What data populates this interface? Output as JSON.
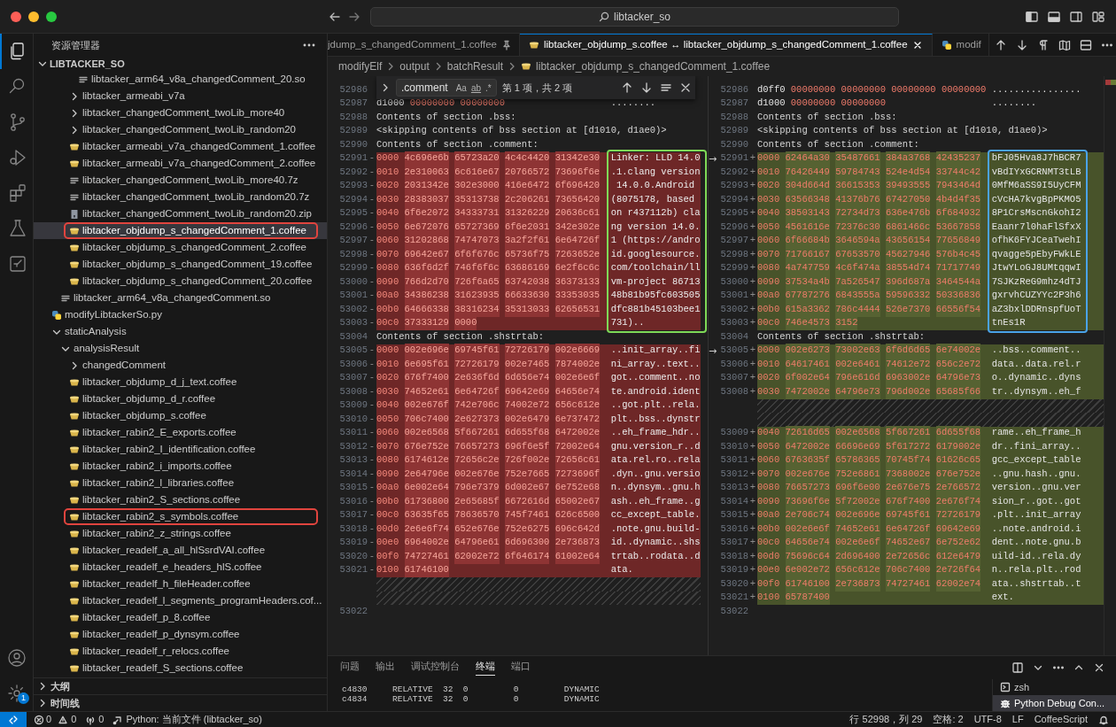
{
  "title_bar": {
    "search": "libtacker_so"
  },
  "activity_bar": {
    "items": [
      {
        "selected": true
      },
      {
        "selected": false
      },
      {
        "selected": false
      },
      {
        "selected": false
      },
      {
        "selected": false
      },
      {
        "selected": false
      },
      {
        "selected": false
      }
    ],
    "settings_badge": "1"
  },
  "sidebar": {
    "title": "资源管理器",
    "root": "LIBTACKER_SO",
    "tree": [
      {
        "children": [
          {
            "children": [
              {
                "children": [
                  {
                    "label": "libtacker_arm64_v8a_changedComment_20.so",
                    "kind": "text",
                    "selected": false,
                    "outlined": false
                  }
                ]
              },
              {
                "label": "libtacker_armeabi_v7a",
                "kind": "folder",
                "expanded": false,
                "selected": false,
                "outlined": false
              },
              {
                "label": "libtacker_changedComment_twoLib_more40",
                "kind": "folder",
                "expanded": false,
                "selected": false,
                "outlined": false
              },
              {
                "label": "libtacker_changedComment_twoLib_random20",
                "kind": "folder",
                "expanded": false,
                "selected": false,
                "outlined": false
              },
              {
                "label": "libtacker_armeabi_v7a_changedComment_1.coffee",
                "kind": "coffee",
                "selected": false,
                "outlined": false
              },
              {
                "label": "libtacker_armeabi_v7a_changedComment_2.coffee",
                "kind": "coffee",
                "selected": false,
                "outlined": false
              },
              {
                "label": "libtacker_changedComment_twoLib_more40.7z",
                "kind": "text",
                "selected": false,
                "outlined": false
              },
              {
                "label": "libtacker_changedComment_twoLib_random20.7z",
                "kind": "text",
                "selected": false,
                "outlined": false
              },
              {
                "label": "libtacker_changedComment_twoLib_random20.zip",
                "kind": "zip",
                "selected": false,
                "outlined": false
              },
              {
                "label": "libtacker_objdump_s_changedComment_1.coffee",
                "kind": "coffee",
                "selected": true,
                "outlined": true
              },
              {
                "label": "libtacker_objdump_s_changedComment_2.coffee",
                "kind": "coffee",
                "selected": false,
                "outlined": false
              },
              {
                "label": "libtacker_objdump_s_changedComment_19.coffee",
                "kind": "coffee",
                "selected": false,
                "outlined": false
              },
              {
                "label": "libtacker_objdump_s_changedComment_20.coffee",
                "kind": "coffee",
                "selected": false,
                "outlined": false
              }
            ]
          },
          {
            "label": "libtacker_arm64_v8a_changedComment.so",
            "kind": "text",
            "selected": false,
            "outlined": false
          }
        ]
      },
      {
        "label": "modifyLibtackerSo.py",
        "kind": "python",
        "selected": false,
        "outlined": false
      },
      {
        "label": "staticAnalysis",
        "kind": "folder",
        "expanded": true,
        "selected": false,
        "outlined": false,
        "children": [
          {
            "label": "analysisResult",
            "kind": "folder",
            "expanded": true,
            "selected": false,
            "outlined": false,
            "children": [
              {
                "label": "changedComment",
                "kind": "folder",
                "expanded": false,
                "selected": false,
                "outlined": false
              },
              {
                "label": "libtacker_objdump_d_j_text.coffee",
                "kind": "coffee",
                "selected": false,
                "outlined": false
              },
              {
                "label": "libtacker_objdump_d_r.coffee",
                "kind": "coffee",
                "selected": false,
                "outlined": false
              },
              {
                "label": "libtacker_objdump_s.coffee",
                "kind": "coffee",
                "selected": false,
                "outlined": false
              },
              {
                "label": "libtacker_rabin2_E_exports.coffee",
                "kind": "coffee",
                "selected": false,
                "outlined": false
              },
              {
                "label": "libtacker_rabin2_I_identification.coffee",
                "kind": "coffee",
                "selected": false,
                "outlined": false
              },
              {
                "label": "libtacker_rabin2_i_imports.coffee",
                "kind": "coffee",
                "selected": false,
                "outlined": false
              },
              {
                "label": "libtacker_rabin2_l_libraries.coffee",
                "kind": "coffee",
                "selected": false,
                "outlined": false
              },
              {
                "label": "libtacker_rabin2_S_sections.coffee",
                "kind": "coffee",
                "selected": false,
                "outlined": false
              },
              {
                "label": "libtacker_rabin2_s_symbols.coffee",
                "kind": "coffee",
                "selected": false,
                "outlined": true
              },
              {
                "label": "libtacker_rabin2_z_strings.coffee",
                "kind": "coffee",
                "selected": false,
                "outlined": false
              },
              {
                "label": "libtacker_readelf_a_all_hlSsrdVAI.coffee",
                "kind": "coffee",
                "selected": false,
                "outlined": false
              },
              {
                "label": "libtacker_readelf_e_headers_hlS.coffee",
                "kind": "coffee",
                "selected": false,
                "outlined": false
              },
              {
                "label": "libtacker_readelf_h_fileHeader.coffee",
                "kind": "coffee",
                "selected": false,
                "outlined": false
              },
              {
                "label": "libtacker_readelf_l_segments_programHeaders.cof...",
                "kind": "coffee",
                "selected": false,
                "outlined": false
              },
              {
                "label": "libtacker_readelf_p_8.coffee",
                "kind": "coffee",
                "selected": false,
                "outlined": false
              },
              {
                "label": "libtacker_readelf_p_dynsym.coffee",
                "kind": "coffee",
                "selected": false,
                "outlined": false
              },
              {
                "label": "libtacker_readelf_r_relocs.coffee",
                "kind": "coffee",
                "selected": false,
                "outlined": false
              },
              {
                "label": "libtacker_readelf_S_sections.coffee",
                "kind": "coffee",
                "selected": false,
                "outlined": false
              }
            ]
          }
        ]
      }
    ],
    "sections": [
      {
        "label": "大纲",
        "expanded": false
      },
      {
        "label": "时间线",
        "expanded": false
      }
    ]
  },
  "editor": {
    "tabs": [
      {
        "label": "jdump_s_changedComment_1.coffee",
        "kind": "plain",
        "pinned": true,
        "selected": false
      },
      {
        "label": "libtacker_objdump_s.coffee ↔ libtacker_objdump_s_changedComment_1.coffee",
        "kind": "coffee",
        "pinned": false,
        "selected": true
      },
      {
        "label": "modif",
        "kind": "python",
        "pinned": false,
        "selected": false
      }
    ],
    "breadcrumb": [
      {
        "label": "modifyElf",
        "kind": "folder"
      },
      {
        "label": "output",
        "kind": "folder"
      },
      {
        "label": "batchResult",
        "kind": "folder"
      },
      {
        "label": "libtacker_objdump_s_changedComment_1.coffee",
        "kind": "coffee"
      }
    ],
    "panes": [
      {
        "find": {
          "query": ".comment",
          "options": [
            "Aa",
            "ab",
            ".*"
          ],
          "count": "第 1 项，共 2 项"
        },
        "blocks": [
          {
            "kind": "context",
            "lines": [
              {
                "kind": "text",
                "n": "52986"
              },
              {
                "kind": "hex",
                "n": "52987",
                "off": "d1000",
                "words": [
                  "00000000",
                  "00000000"
                ],
                "ascii": "........"
              },
              {
                "kind": "text",
                "n": "52988",
                "text": "Contents of section .bss:"
              },
              {
                "kind": "text",
                "n": "52989",
                "text": "<skipping contents of bss section at [d1010, d1ae0)>"
              },
              {
                "kind": "text",
                "n": "52990",
                "text": "Contents of section .comment:"
              }
            ]
          },
          {
            "kind": "removed",
            "color": "#7ed957",
            "lines": [
              {
                "kind": "hex",
                "n": "52991",
                "mark": "-",
                "off": "0000",
                "words": [
                  "4c696e6b",
                  "65723a20",
                  "4c4c4420",
                  "31342e30"
                ],
                "ascii": "Linker: LLD 14.0"
              },
              {
                "kind": "hex",
                "n": "52992",
                "mark": "-",
                "off": "0010",
                "words": [
                  "2e310063",
                  "6c616e67",
                  "20766572",
                  "73696f6e"
                ],
                "ascii": ".1.clang version"
              },
              {
                "kind": "hex",
                "n": "52993",
                "mark": "-",
                "off": "0020",
                "words": [
                  "2031342e",
                  "302e3000",
                  "416e6472",
                  "6f696420"
                ],
                "ascii": " 14.0.0.Android"
              },
              {
                "kind": "hex",
                "n": "52994",
                "mark": "-",
                "off": "0030",
                "words": [
                  "28383037",
                  "35313738",
                  "2c206261",
                  "73656420"
                ],
                "ascii": "(8075178, based"
              },
              {
                "kind": "hex",
                "n": "52995",
                "mark": "-",
                "off": "0040",
                "words": [
                  "6f6e2072",
                  "34333731",
                  "31326229",
                  "20636c61"
                ],
                "ascii": "on r437112b) cla"
              },
              {
                "kind": "hex",
                "n": "52996",
                "mark": "-",
                "off": "0050",
                "words": [
                  "6e672076",
                  "65727369",
                  "6f6e2031",
                  "342e302e"
                ],
                "ascii": "ng version 14.0."
              },
              {
                "kind": "hex",
                "n": "52997",
                "mark": "-",
                "off": "0060",
                "words": [
                  "31202868",
                  "74747073",
                  "3a2f2f61",
                  "6e64726f"
                ],
                "ascii": "1 (https://andro"
              },
              {
                "kind": "hex",
                "n": "52998",
                "mark": "-",
                "off": "0070",
                "words": [
                  "69642e67",
                  "6f6f676c",
                  "65736f75",
                  "7263652e"
                ],
                "ascii": "id.googlesource."
              },
              {
                "kind": "hex",
                "n": "52999",
                "mark": "-",
                "off": "0080",
                "words": [
                  "636f6d2f",
                  "746f6f6c",
                  "63686169",
                  "6e2f6c6c"
                ],
                "ascii": "com/toolchain/ll"
              },
              {
                "kind": "hex",
                "n": "53000",
                "mark": "-",
                "off": "0090",
                "words": [
                  "766d2d70",
                  "726f6a65",
                  "63742038",
                  "36373133"
                ],
                "ascii": "vm-project 86713"
              },
              {
                "kind": "hex",
                "n": "53001",
                "mark": "-",
                "off": "00a0",
                "words": [
                  "34386238",
                  "31623935",
                  "66633630",
                  "33353035"
                ],
                "ascii": "48b81b95fc603505"
              },
              {
                "kind": "hex",
                "n": "53002",
                "mark": "-",
                "off": "00b0",
                "words": [
                  "64666338",
                  "38316234",
                  "35313033",
                  "62656531"
                ],
                "ascii": "dfc881b45103bee1"
              },
              {
                "kind": "hex",
                "n": "53003",
                "mark": "-",
                "off": "00c0",
                "words": [
                  "37333129",
                  "0000"
                ],
                "ascii": "731).."
              }
            ]
          },
          {
            "kind": "context",
            "lines": [
              {
                "kind": "text",
                "n": "53004",
                "text": "Contents of section .shstrtab:"
              }
            ]
          },
          {
            "kind": "removed",
            "lines": [
              {
                "kind": "hex",
                "n": "53005",
                "mark": "-",
                "off": "0000",
                "words": [
                  "002e696e",
                  "69745f61",
                  "72726179",
                  "002e6669"
                ],
                "ascii": "..init_array..fi"
              },
              {
                "kind": "hex",
                "n": "53006",
                "mark": "-",
                "off": "0010",
                "words": [
                  "6e695f61",
                  "72726179",
                  "002e7465",
                  "7874002e"
                ],
                "ascii": "ni_array..text.."
              },
              {
                "kind": "hex",
                "n": "53007",
                "mark": "-",
                "off": "0020",
                "words": [
                  "676f7400",
                  "2e636f6d",
                  "6d656e74",
                  "002e6e6f"
                ],
                "ascii": "got..comment..no"
              },
              {
                "kind": "hex",
                "n": "53008",
                "mark": "-",
                "off": "0030",
                "words": [
                  "74652e61",
                  "6e64726f",
                  "69642e69",
                  "64656e74"
                ],
                "ascii": "te.android.ident"
              },
              {
                "kind": "hex",
                "n": "53009",
                "mark": "-",
                "off": "0040",
                "words": [
                  "002e676f",
                  "742e706c",
                  "74002e72",
                  "656c612e"
                ],
                "ascii": "..got.plt..rela."
              },
              {
                "kind": "hex",
                "n": "53010",
                "mark": "-",
                "off": "0050",
                "words": [
                  "706c7400",
                  "2e627373",
                  "002e6479",
                  "6e737472"
                ],
                "ascii": "plt..bss..dynstr"
              },
              {
                "kind": "hex",
                "n": "53011",
                "mark": "-",
                "off": "0060",
                "words": [
                  "002e6568",
                  "5f667261",
                  "6d655f68",
                  "6472002e"
                ],
                "ascii": "..eh_frame_hdr.."
              },
              {
                "kind": "hex",
                "n": "53012",
                "mark": "-",
                "off": "0070",
                "words": [
                  "676e752e",
                  "76657273",
                  "696f6e5f",
                  "72002e64"
                ],
                "ascii": "gnu.version_r..d"
              },
              {
                "kind": "hex",
                "n": "53013",
                "mark": "-",
                "off": "0080",
                "words": [
                  "6174612e",
                  "72656c2e",
                  "726f002e",
                  "72656c61"
                ],
                "ascii": "ata.rel.ro..rela"
              },
              {
                "kind": "hex",
                "n": "53014",
                "mark": "-",
                "off": "0090",
                "words": [
                  "2e64796e",
                  "002e676e",
                  "752e7665",
                  "7273696f"
                ],
                "ascii": ".dyn..gnu.versio"
              },
              {
                "kind": "hex",
                "n": "53015",
                "mark": "-",
                "off": "00a0",
                "words": [
                  "6e002e64",
                  "796e7379",
                  "6d002e67",
                  "6e752e68"
                ],
                "ascii": "n..dynsym..gnu.h"
              },
              {
                "kind": "hex",
                "n": "53016",
                "mark": "-",
                "off": "00b0",
                "words": [
                  "61736800",
                  "2e65685f",
                  "6672616d",
                  "65002e67"
                ],
                "ascii": "ash..eh_frame..g"
              },
              {
                "kind": "hex",
                "n": "53017",
                "mark": "-",
                "off": "00c0",
                "words": [
                  "63635f65",
                  "78636570",
                  "745f7461",
                  "626c6500"
                ],
                "ascii": "cc_except_table."
              },
              {
                "kind": "hex",
                "n": "53018",
                "mark": "-",
                "off": "00d0",
                "words": [
                  "2e6e6f74",
                  "652e676e",
                  "752e6275",
                  "696c642d"
                ],
                "ascii": ".note.gnu.build-"
              },
              {
                "kind": "hex",
                "n": "53019",
                "mark": "-",
                "off": "00e0",
                "words": [
                  "6964002e",
                  "64796e61",
                  "6d696300",
                  "2e736873"
                ],
                "ascii": "id..dynamic..shs"
              },
              {
                "kind": "hex",
                "n": "53020",
                "mark": "-",
                "off": "00f0",
                "words": [
                  "74727461",
                  "62002e72",
                  "6f646174",
                  "61002e64"
                ],
                "ascii": "trtab..rodata..d"
              },
              {
                "kind": "hex",
                "n": "53021",
                "mark": "-",
                "off": "0100",
                "words": [
                  "61746100"
                ],
                "ascii": "ata."
              }
            ]
          },
          {
            "kind": "filler",
            "lines": [
              {
                "kind": "blank"
              },
              {
                "kind": "blank"
              }
            ]
          },
          {
            "kind": "context",
            "lines": [
              {
                "kind": "text",
                "n": "53022"
              }
            ]
          }
        ]
      },
      {
        "blocks": [
          {
            "kind": "context",
            "lines": [
              {
                "kind": "hex",
                "n": "52986",
                "off": "d0ff0",
                "words": [
                  "00000000",
                  "00000000",
                  "00000000",
                  "00000000"
                ],
                "ascii": "................"
              },
              {
                "kind": "hex",
                "n": "52987",
                "off": "d1000",
                "words": [
                  "00000000",
                  "00000000"
                ],
                "ascii": "........"
              },
              {
                "kind": "text",
                "n": "52988",
                "text": "Contents of section .bss:"
              },
              {
                "kind": "text",
                "n": "52989",
                "text": "<skipping contents of bss section at [d1010, d1ae0)>"
              },
              {
                "kind": "text",
                "n": "52990",
                "text": "Contents of section .comment:"
              }
            ]
          },
          {
            "kind": "added",
            "color": "#4aa3e8",
            "lines": [
              {
                "kind": "hex",
                "n": "52991",
                "arrow": "→",
                "mark": "+",
                "off": "0000",
                "words": [
                  "62464a30",
                  "35487661",
                  "384a3768",
                  "42435237"
                ],
                "ascii": "bFJ05Hva8J7hBCR7"
              },
              {
                "kind": "hex",
                "n": "52992",
                "mark": "+",
                "off": "0010",
                "words": [
                  "76426449",
                  "59784743",
                  "524e4d54",
                  "33744c42"
                ],
                "ascii": "vBdIYxGCRNMT3tLB"
              },
              {
                "kind": "hex",
                "n": "52993",
                "mark": "+",
                "off": "0020",
                "words": [
                  "304d664d",
                  "36615353",
                  "39493555",
                  "7943464d"
                ],
                "ascii": "0MfM6aSS9I5UyCFM"
              },
              {
                "kind": "hex",
                "n": "52994",
                "mark": "+",
                "off": "0030",
                "words": [
                  "63566348",
                  "41376b76",
                  "67427050",
                  "4b4d4f35"
                ],
                "ascii": "cVcHA7kvgBpPKMO5"
              },
              {
                "kind": "hex",
                "n": "52995",
                "mark": "+",
                "off": "0040",
                "words": [
                  "38503143",
                  "72734d73",
                  "636e476b",
                  "6f684932"
                ],
                "ascii": "8P1CrsMscnGkohI2"
              },
              {
                "kind": "hex",
                "n": "52996",
                "mark": "+",
                "off": "0050",
                "words": [
                  "4561616e",
                  "72376c30",
                  "6861466c",
                  "53667858"
                ],
                "ascii": "Eaanr7l0haFlSfxX"
              },
              {
                "kind": "hex",
                "n": "52997",
                "mark": "+",
                "off": "0060",
                "words": [
                  "6f66684b",
                  "3646594a",
                  "43656154",
                  "77656849"
                ],
                "ascii": "ofhK6FYJCeaTwehI"
              },
              {
                "kind": "hex",
                "n": "52998",
                "mark": "+",
                "off": "0070",
                "words": [
                  "71766167",
                  "67653570",
                  "45627946",
                  "576b4c45"
                ],
                "ascii": "qvagge5pEbyFWkLE"
              },
              {
                "kind": "hex",
                "n": "52999",
                "mark": "+",
                "off": "0080",
                "words": [
                  "4a747759",
                  "4c6f474a",
                  "38554d74",
                  "71717749"
                ],
                "ascii": "JtwYLoGJ8UMtqqwI"
              },
              {
                "kind": "hex",
                "n": "53000",
                "mark": "+",
                "off": "0090",
                "words": [
                  "37534a4b",
                  "7a526547",
                  "396d687a",
                  "3464544a"
                ],
                "ascii": "7SJKzReG9mhz4dTJ"
              },
              {
                "kind": "hex",
                "n": "53001",
                "mark": "+",
                "off": "00a0",
                "words": [
                  "67787276",
                  "6843555a",
                  "59596332",
                  "50336836"
                ],
                "ascii": "gxrvhCUZYYc2P3h6"
              },
              {
                "kind": "hex",
                "n": "53002",
                "mark": "+",
                "off": "00b0",
                "words": [
                  "615a3362",
                  "786c4444",
                  "526e7370",
                  "66556f54"
                ],
                "ascii": "aZ3bxlDDRnspfUoT"
              },
              {
                "kind": "hex",
                "n": "53003",
                "mark": "+",
                "off": "00c0",
                "words": [
                  "746e4573",
                  "3152"
                ],
                "ascii": "tnEs1R"
              }
            ]
          },
          {
            "kind": "context",
            "lines": [
              {
                "kind": "text",
                "n": "53004",
                "text": "Contents of section .shstrtab:"
              }
            ]
          },
          {
            "kind": "added",
            "lines": [
              {
                "kind": "hex",
                "n": "53005",
                "arrow": "→",
                "mark": "+",
                "off": "0000",
                "words": [
                  "002e6273",
                  "73002e63",
                  "6f6d6d65",
                  "6e74002e"
                ],
                "ascii": "..bss..comment.."
              },
              {
                "kind": "hex",
                "n": "53006",
                "mark": "+",
                "off": "0010",
                "words": [
                  "64617461",
                  "002e6461",
                  "74612e72",
                  "656c2e72"
                ],
                "ascii": "data..data.rel.r"
              },
              {
                "kind": "hex",
                "n": "53007",
                "mark": "+",
                "off": "0020",
                "words": [
                  "6f002e64",
                  "796e616d",
                  "6963002e",
                  "64796e73"
                ],
                "ascii": "o..dynamic..dyns"
              },
              {
                "kind": "hex",
                "n": "53008",
                "mark": "+",
                "off": "0030",
                "words": [
                  "7472002e",
                  "64796e73",
                  "796d002e",
                  "65685f66"
                ],
                "ascii": "tr..dynsym..eh_f"
              }
            ]
          },
          {
            "kind": "filler",
            "lines": [
              {
                "kind": "blank"
              },
              {
                "kind": "blank"
              }
            ]
          },
          {
            "kind": "added",
            "lines": [
              {
                "kind": "hex",
                "n": "53009",
                "mark": "+",
                "off": "0040",
                "words": [
                  "72616d65",
                  "002e6568",
                  "5f667261",
                  "6d655f68"
                ],
                "ascii": "rame..eh_frame_h"
              },
              {
                "kind": "hex",
                "n": "53010",
                "mark": "+",
                "off": "0050",
                "words": [
                  "6472002e",
                  "66696e69",
                  "5f617272",
                  "6179002e"
                ],
                "ascii": "dr..fini_array.."
              },
              {
                "kind": "hex",
                "n": "53011",
                "mark": "+",
                "off": "0060",
                "words": [
                  "6763635f",
                  "65786365",
                  "70745f74",
                  "61626c65"
                ],
                "ascii": "gcc_except_table"
              },
              {
                "kind": "hex",
                "n": "53012",
                "mark": "+",
                "off": "0070",
                "words": [
                  "002e676e",
                  "752e6861",
                  "7368002e",
                  "676e752e"
                ],
                "ascii": "..gnu.hash..gnu."
              },
              {
                "kind": "hex",
                "n": "53013",
                "mark": "+",
                "off": "0080",
                "words": [
                  "76657273",
                  "696f6e00",
                  "2e676e75",
                  "2e766572"
                ],
                "ascii": "version..gnu.ver"
              },
              {
                "kind": "hex",
                "n": "53014",
                "mark": "+",
                "off": "0090",
                "words": [
                  "73696f6e",
                  "5f72002e",
                  "676f7400",
                  "2e676f74"
                ],
                "ascii": "sion_r..got..got"
              },
              {
                "kind": "hex",
                "n": "53015",
                "mark": "+",
                "off": "00a0",
                "words": [
                  "2e706c74",
                  "002e696e",
                  "69745f61",
                  "72726179"
                ],
                "ascii": ".plt..init_array"
              },
              {
                "kind": "hex",
                "n": "53016",
                "mark": "+",
                "off": "00b0",
                "words": [
                  "002e6e6f",
                  "74652e61",
                  "6e64726f",
                  "69642e69"
                ],
                "ascii": "..note.android.i"
              },
              {
                "kind": "hex",
                "n": "53017",
                "mark": "+",
                "off": "00c0",
                "words": [
                  "64656e74",
                  "002e6e6f",
                  "74652e67",
                  "6e752e62"
                ],
                "ascii": "dent..note.gnu.b"
              },
              {
                "kind": "hex",
                "n": "53018",
                "mark": "+",
                "off": "00d0",
                "words": [
                  "75696c64",
                  "2d696400",
                  "2e72656c",
                  "612e6479"
                ],
                "ascii": "uild-id..rela.dy"
              },
              {
                "kind": "hex",
                "n": "53019",
                "mark": "+",
                "off": "00e0",
                "words": [
                  "6e002e72",
                  "656c612e",
                  "706c7400",
                  "2e726f64"
                ],
                "ascii": "n..rela.plt..rod"
              },
              {
                "kind": "hex",
                "n": "53020",
                "mark": "+",
                "off": "00f0",
                "words": [
                  "61746100",
                  "2e736873",
                  "74727461",
                  "62002e74"
                ],
                "ascii": "ata..shstrtab..t"
              },
              {
                "kind": "hex",
                "n": "53021",
                "mark": "+",
                "off": "0100",
                "words": [
                  "65787400"
                ],
                "ascii": "ext."
              }
            ]
          },
          {
            "kind": "context",
            "lines": [
              {
                "kind": "text",
                "n": "53022"
              }
            ]
          }
        ]
      }
    ]
  },
  "panel": {
    "tabs": [
      {
        "label": "问题",
        "selected": false
      },
      {
        "label": "输出",
        "selected": false
      },
      {
        "label": "调试控制台",
        "selected": false
      },
      {
        "label": "终端",
        "selected": true
      },
      {
        "label": "端口",
        "selected": false
      }
    ],
    "terminal_lines": [
      "c4830     RELATIVE  32  0         0         DYNAMIC",
      "c4834     RELATIVE  32  0         0         DYNAMIC"
    ],
    "terminals": [
      {
        "label": "zsh",
        "kind": "shell",
        "selected": false
      },
      {
        "label": "Python Debug Con...",
        "kind": "debug",
        "selected": true
      }
    ]
  },
  "status_bar": {
    "errors": "0",
    "warnings": "0",
    "ports": "0",
    "python": "Python: 当前文件 (libtacker_so)",
    "right": [
      "行 52998，列 29",
      "空格: 2",
      "UTF-8",
      "LF",
      "CoffeeScript"
    ]
  }
}
